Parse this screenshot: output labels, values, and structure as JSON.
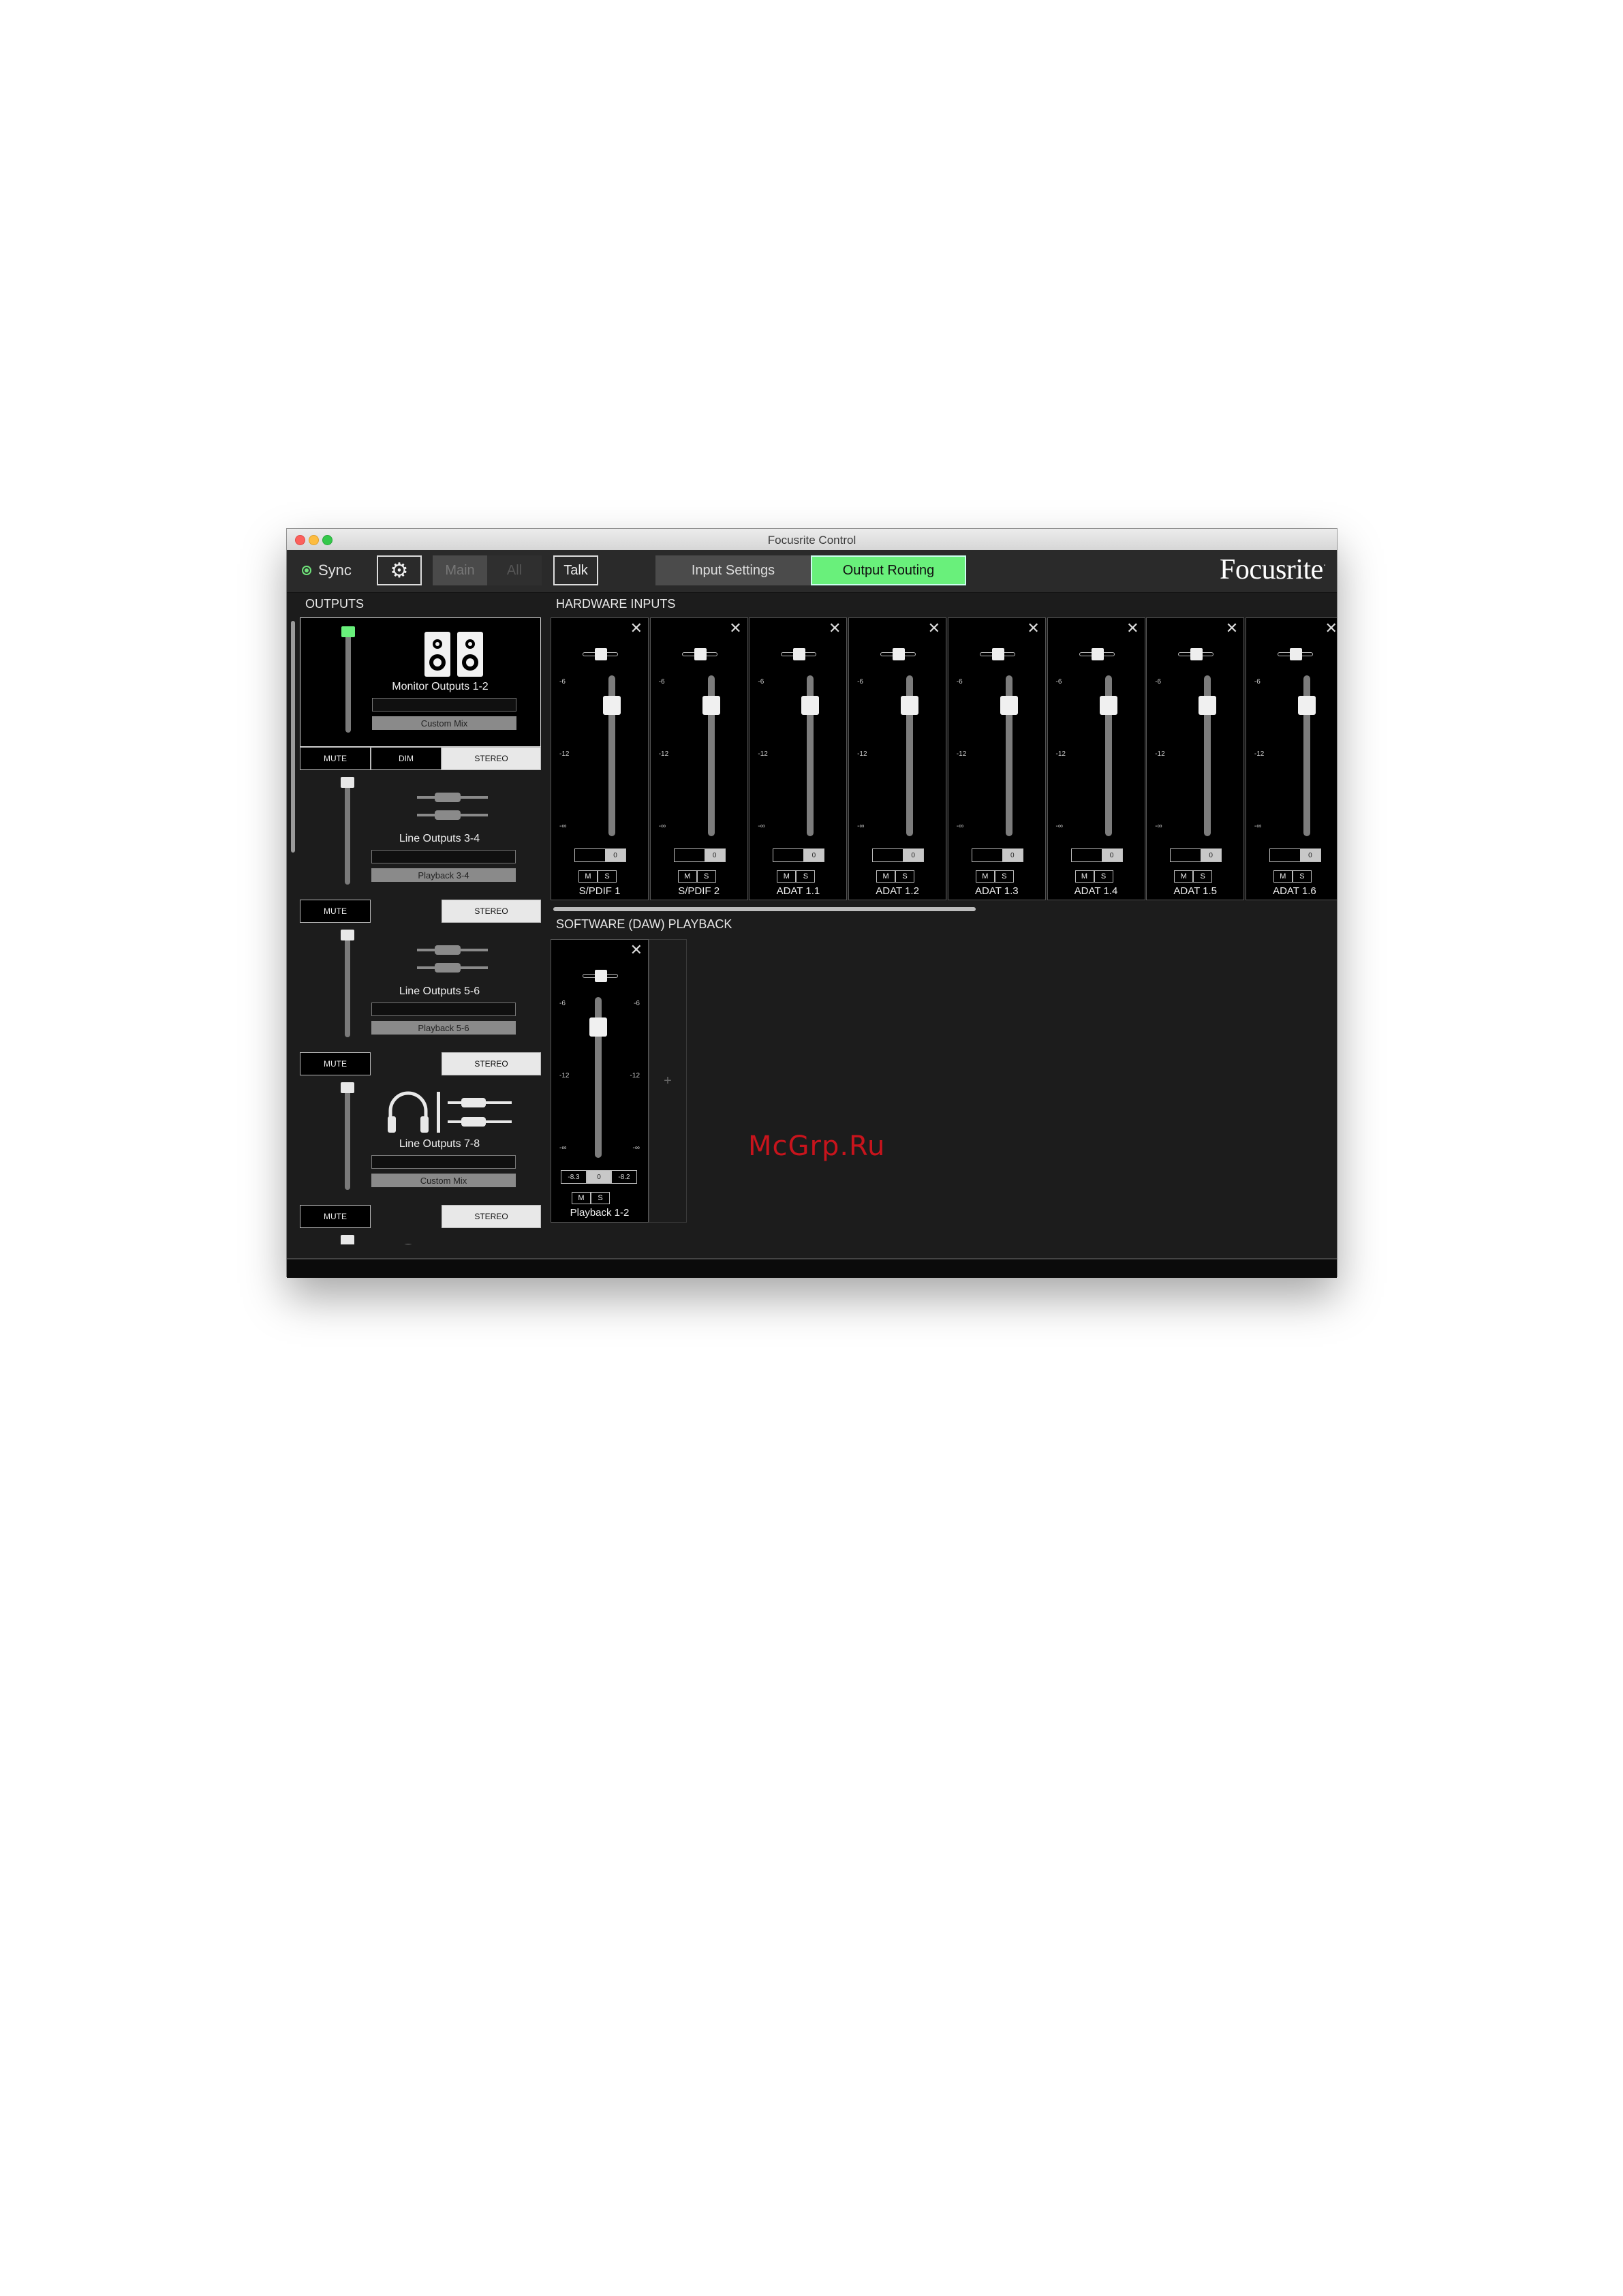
{
  "window": {
    "title": "Focusrite Control"
  },
  "toolbar": {
    "sync_label": "Sync",
    "main_label": "Main",
    "all_label": "All",
    "talk_label": "Talk",
    "tab_input": "Input Settings",
    "tab_output": "Output Routing",
    "logo": "Focusrite",
    "accent": "#69f07b"
  },
  "outputs": {
    "label": "OUTPUTS",
    "items": [
      {
        "name": "Monitor Outputs 1-2",
        "source": "Custom Mix",
        "icon": "speakers-icon",
        "buttons": [
          "MUTE",
          "DIM",
          "STEREO"
        ]
      },
      {
        "name": "Line Outputs 3-4",
        "source": "Playback 3-4",
        "icon": "line-jacks-icon",
        "buttons": [
          "MUTE",
          "STEREO"
        ]
      },
      {
        "name": "Line Outputs 5-6",
        "source": "Playback 5-6",
        "icon": "line-jacks-icon",
        "buttons": [
          "MUTE",
          "STEREO"
        ]
      },
      {
        "name": "Line Outputs 7-8",
        "source": "Custom Mix",
        "icon": "headphones-icon",
        "buttons": [
          "MUTE",
          "STEREO"
        ]
      }
    ]
  },
  "hardware_inputs": {
    "label": "HARDWARE INPUTS",
    "scale": [
      "-6",
      "-12",
      "-∞"
    ],
    "value": "0",
    "mute": "M",
    "solo": "S",
    "channels": [
      "S/PDIF 1",
      "S/PDIF 2",
      "ADAT 1.1",
      "ADAT 1.2",
      "ADAT 1.3",
      "ADAT 1.4",
      "ADAT 1.5",
      "ADAT 1.6"
    ]
  },
  "daw": {
    "label": "SOFTWARE (DAW) PLAYBACK",
    "name": "Playback 1-2",
    "left_val": "-8.3",
    "mid_val": "0",
    "right_val": "-8.2",
    "mute": "M",
    "solo": "S",
    "add": "+"
  },
  "watermark": "McGrp.Ru"
}
